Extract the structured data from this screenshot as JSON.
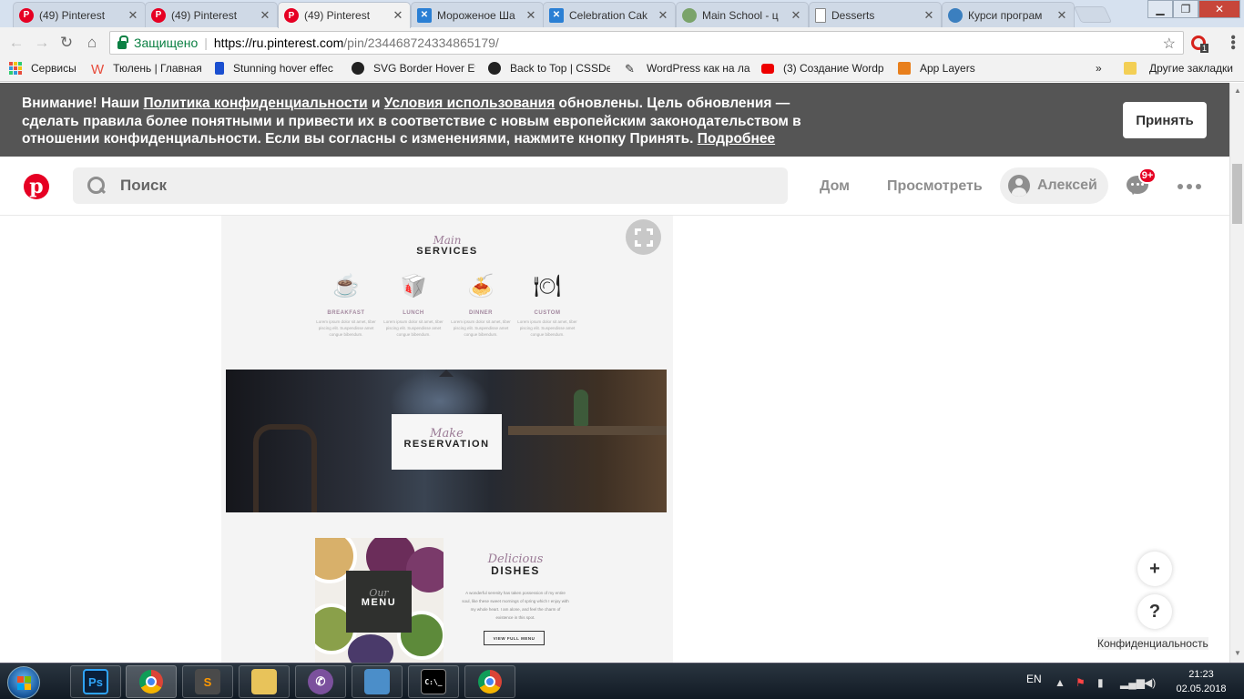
{
  "browser": {
    "tabs": [
      {
        "title": "(49) Pinterest",
        "favicon": "pinterest-icon",
        "active": false
      },
      {
        "title": "(49) Pinterest",
        "favicon": "pinterest-icon",
        "active": false
      },
      {
        "title": "(49) Pinterest",
        "favicon": "pinterest-icon",
        "active": true
      },
      {
        "title": "Мороженое Ша",
        "favicon": "x-icon",
        "active": false
      },
      {
        "title": "Celebration Cak",
        "favicon": "x-icon",
        "active": false
      },
      {
        "title": "Main School - ц",
        "favicon": "globe-icon",
        "active": false
      },
      {
        "title": "Desserts",
        "favicon": "document-icon",
        "active": false
      },
      {
        "title": "Курси програм",
        "favicon": "globe-icon",
        "active": false
      }
    ],
    "secure_label": "Защищено",
    "url_host": "https://ru.pinterest.com",
    "url_path": "/pin/234468724334865179/",
    "extension_badge": "1",
    "bookmarks": [
      {
        "label": "Сервисы",
        "icon": "apps-icon"
      },
      {
        "label": "Тюлень | Главная",
        "icon": "w-icon"
      },
      {
        "label": "Stunning hover effec",
        "icon": "p-icon"
      },
      {
        "label": "SVG Border Hover Ef",
        "icon": "github-icon"
      },
      {
        "label": "Back to Top | CSSDe",
        "icon": "github-icon"
      },
      {
        "label": "WordPress как на ла",
        "icon": "feather-icon"
      },
      {
        "label": "(3) Создание Wordp",
        "icon": "youtube-icon"
      },
      {
        "label": "App Layers",
        "icon": "app-layers-icon"
      }
    ],
    "bookmarks_more": "»",
    "other_bookmarks": "Другие закладки"
  },
  "consent": {
    "prefix": "Внимание! Наши ",
    "privacy_link": "Политика конфиденциальности",
    "and": " и ",
    "terms_link": "Условия использования",
    "body": " обновлены. Цель обновления — сделать правила более понятными и привести их в соответствие с новым европейским законодательством в отношении конфиденциальности. Если вы согласны с изменениями, нажмите кнопку Принять. ",
    "more_link": "Подробнее",
    "accept": "Принять"
  },
  "pinterest": {
    "search_placeholder": "Поиск",
    "nav_home": "Дом",
    "nav_explore": "Просмотреть",
    "user_name": "Алексей",
    "notifications_badge": "9+",
    "brand_color": "#e60023"
  },
  "pin": {
    "services_script": "Main",
    "services_title": "SERVICES",
    "services": [
      {
        "label": "BREAKFAST",
        "icon": "coffee-cup-icon",
        "desc": "Lorem ipsum dolor sit amet, tiber piscing elit. Suspendisse amet congue bibendum."
      },
      {
        "label": "LUNCH",
        "icon": "takeout-box-icon",
        "desc": "Lorem ipsum dolor sit amet, tiber piscing elit. Suspendisse amet congue bibendum."
      },
      {
        "label": "DINNER",
        "icon": "pasta-plate-icon",
        "desc": "Lorem ipsum dolor sit amet, tiber piscing elit. Suspendisse amet congue bibendum."
      },
      {
        "label": "CUSTOM",
        "icon": "plate-cutlery-icon",
        "desc": "Lorem ipsum dolor sit amet, tiber piscing elit. Suspendisse amet congue bibendum."
      }
    ],
    "reservation_script": "Make",
    "reservation_title": "RESERVATION",
    "menu_script": "Our",
    "menu_title": "MENU",
    "dishes_script": "Delicious",
    "dishes_title": "DISHES",
    "dishes_desc": "A wonderful serenity has taken possession of my entire soul, like these sweet mornings of spring which I enjoy with my whole heart. I am alone, and feel the charm of existence in this spot.",
    "view_menu": "VIEW FULL MENU"
  },
  "floating": {
    "plus": "+",
    "help": "?",
    "privacy": "Конфиденциальность"
  },
  "taskbar": {
    "apps": [
      "windows-explorer",
      "photoshop",
      "chrome",
      "sublime-text",
      "file-manager",
      "viber",
      "control-panel",
      "command-prompt",
      "chrome"
    ],
    "photoshop_label": "Ps",
    "cmd_label": "C:\\_",
    "lang": "EN",
    "time": "21:23",
    "date": "02.05.2018"
  }
}
